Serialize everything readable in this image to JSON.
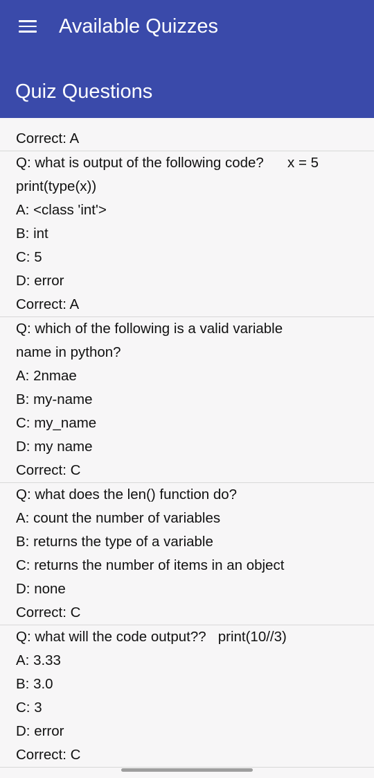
{
  "appbar": {
    "title": "Available Quizzes",
    "subtitle": "Quiz Questions",
    "background": "#3a4aaa",
    "menu_icon": "hamburger-menu-icon"
  },
  "quiz": {
    "intro_correct": "Correct: A",
    "questions": [
      {
        "question_line1": "Q: what is output of the following code?      x = 5",
        "question_line2": "print(type(x))",
        "a": "A: <class 'int'>",
        "b": "B: int",
        "c": "C: 5",
        "d": "D: error",
        "correct": "Correct: A"
      },
      {
        "question_line1": "Q: which of the following is a valid variable",
        "question_line2": "name in python?",
        "a": "A: 2nmae",
        "b": "B: my-name",
        "c": "C: my_name",
        "d": "D: my name",
        "correct": "Correct: C"
      },
      {
        "question_line1": "Q: what does the len() function do?",
        "a": "A: count the number of variables",
        "b": "B: returns the type of a variable",
        "c": "C: returns the number of items in an object",
        "d": "D: none",
        "correct": "Correct: C"
      },
      {
        "question_line1": "Q: what will the code output??   print(10//3)",
        "a": "A: 3.33",
        "b": "B: 3.0",
        "c": "C: 3",
        "d": "D: error",
        "correct": "Correct: C"
      }
    ]
  }
}
